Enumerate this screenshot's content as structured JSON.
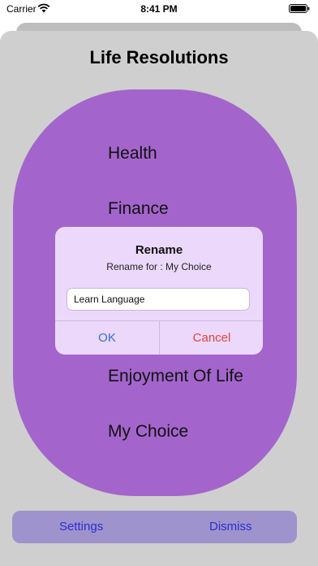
{
  "status_bar": {
    "carrier": "Carrier",
    "time": "8:41 PM"
  },
  "page_title": "Life Resolutions",
  "resolutions": [
    "Health",
    "Finance",
    "Enjoyment Of Life",
    "My Choice"
  ],
  "dialog": {
    "title": "Rename",
    "message": "Rename for : My Choice",
    "input_value": "Learn Language",
    "ok_label": "OK",
    "cancel_label": "Cancel"
  },
  "bottom_bar": {
    "settings_label": "Settings",
    "dismiss_label": "Dismiss"
  },
  "colors": {
    "card": "#a365cc",
    "dialog_bg": "#ecd8fb",
    "ok": "#2f72d8",
    "cancel": "#e4423b",
    "bottom_bar": "#9e93cc",
    "bottom_text": "#2a2fd0"
  }
}
